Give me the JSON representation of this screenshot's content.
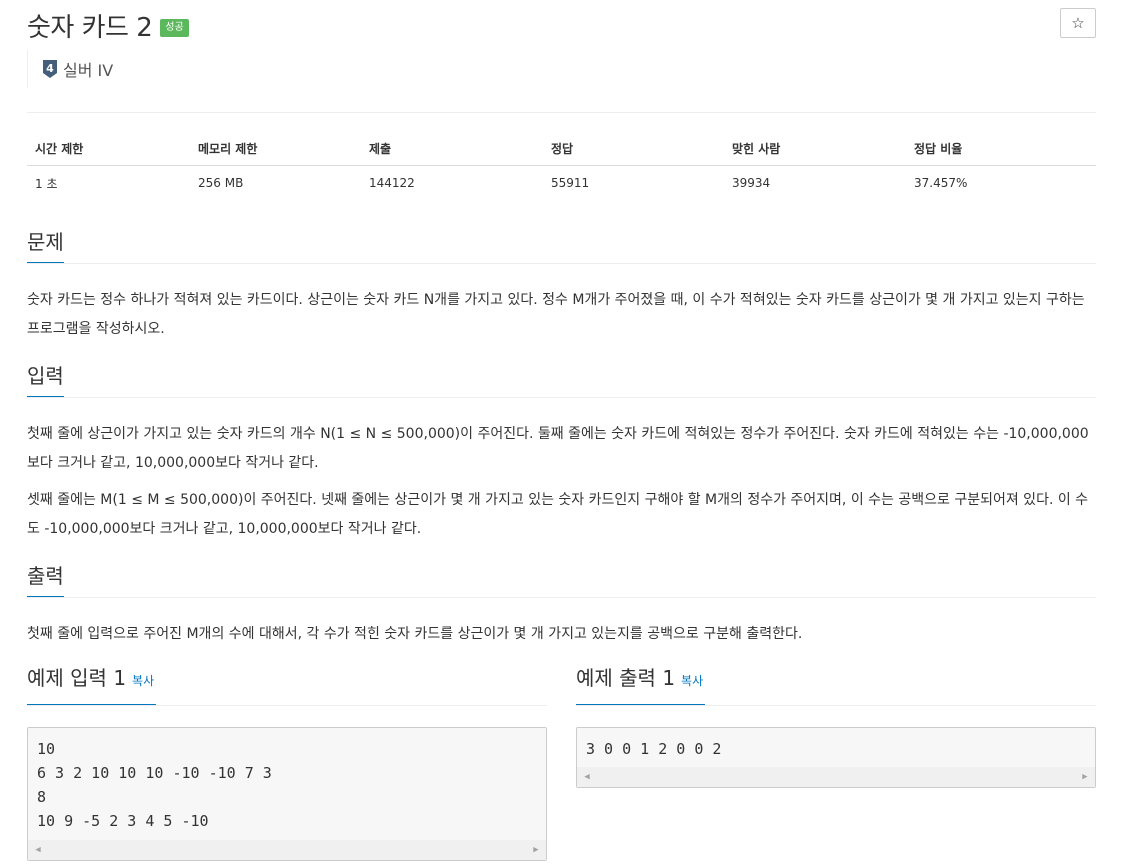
{
  "problem": {
    "title": "숫자 카드 2",
    "status_badge": "성공",
    "star_icon": "☆",
    "tier_number": "4",
    "tier_label": "실버 IV"
  },
  "stats": {
    "headers": [
      "시간 제한",
      "메모리 제한",
      "제출",
      "정답",
      "맞힌 사람",
      "정답 비율"
    ],
    "values": [
      "1 초",
      "256 MB",
      "144122",
      "55911",
      "39934",
      "37.457%"
    ]
  },
  "sections": {
    "description": {
      "heading": "문제",
      "text": "숫자 카드는 정수 하나가 적혀져 있는 카드이다. 상근이는 숫자 카드 N개를 가지고 있다. 정수 M개가 주어졌을 때, 이 수가 적혀있는 숫자 카드를 상근이가 몇 개 가지고 있는지 구하는 프로그램을 작성하시오."
    },
    "input": {
      "heading": "입력",
      "para1": "첫째 줄에 상근이가 가지고 있는 숫자 카드의 개수 N(1 ≤ N ≤ 500,000)이 주어진다. 둘째 줄에는 숫자 카드에 적혀있는 정수가 주어진다. 숫자 카드에 적혀있는 수는 -10,000,000보다 크거나 같고, 10,000,000보다 작거나 같다.",
      "para2": "셋째 줄에는 M(1 ≤ M ≤ 500,000)이 주어진다. 넷째 줄에는 상근이가 몇 개 가지고 있는 숫자 카드인지 구해야 할 M개의 정수가 주어지며, 이 수는 공백으로 구분되어져 있다. 이 수도 -10,000,000보다 크거나 같고, 10,000,000보다 작거나 같다."
    },
    "output": {
      "heading": "출력",
      "text": "첫째 줄에 입력으로 주어진 M개의 수에 대해서, 각 수가 적힌 숫자 카드를 상근이가 몇 개 가지고 있는지를 공백으로 구분해 출력한다."
    }
  },
  "samples": {
    "input_heading": "예제 입력 1",
    "output_heading": "예제 출력 1",
    "copy_label": "복사",
    "input_code": "10\n6 3 2 10 10 10 -10 -10 7 3\n8\n10 9 -5 2 3 4 5 -10",
    "output_code": "3 0 0 1 2 0 0 2"
  }
}
